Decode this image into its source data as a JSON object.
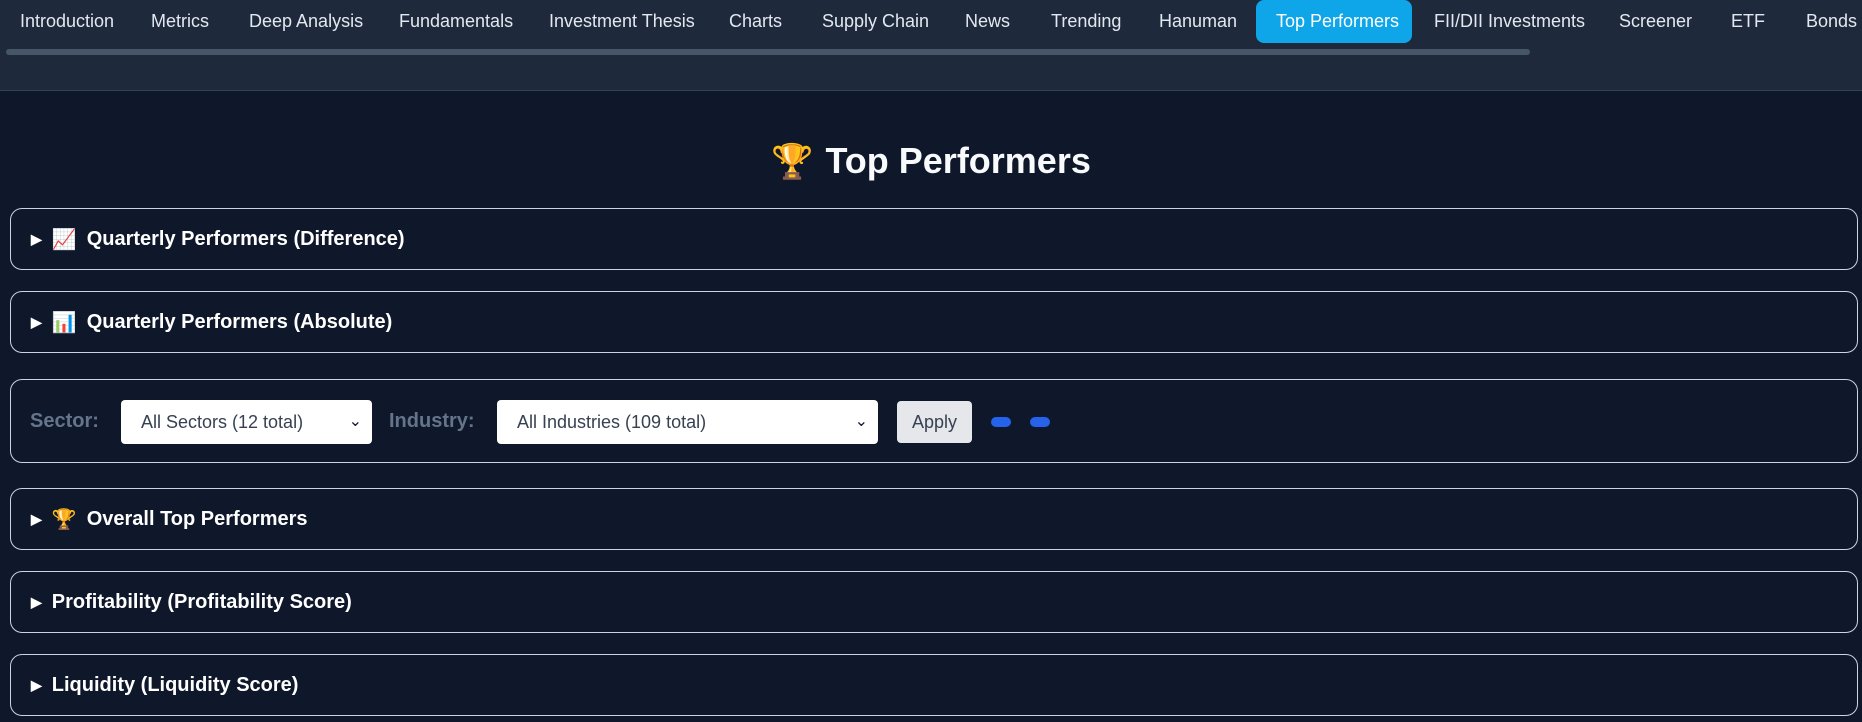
{
  "nav": {
    "tabs": [
      {
        "label": "Introduction",
        "active": false
      },
      {
        "label": "Metrics",
        "active": false
      },
      {
        "label": "Deep Analysis",
        "active": false
      },
      {
        "label": "Fundamentals",
        "active": false
      },
      {
        "label": "Investment Thesis",
        "active": false
      },
      {
        "label": "Charts",
        "active": false
      },
      {
        "label": "Supply Chain",
        "active": false
      },
      {
        "label": "News",
        "active": false
      },
      {
        "label": "Trending",
        "active": false
      },
      {
        "label": "Hanuman",
        "active": false
      },
      {
        "label": "Top Performers",
        "active": true
      },
      {
        "label": "FII/DII Investments",
        "active": false
      },
      {
        "label": "Screener",
        "active": false
      },
      {
        "label": "ETF",
        "active": false
      },
      {
        "label": "Bonds",
        "active": false
      }
    ]
  },
  "page": {
    "title": "Top Performers",
    "title_emoji": "🏆"
  },
  "sections": {
    "quarterly_diff": {
      "label": "Quarterly Performers (Difference)",
      "emoji": "📈"
    },
    "quarterly_abs": {
      "label": "Quarterly Performers (Absolute)",
      "emoji": "📊"
    },
    "overall": {
      "label": "Overall Top Performers",
      "emoji": "🏆"
    },
    "profitability": {
      "label": "Profitability (Profitability Score)"
    },
    "liquidity": {
      "label": "Liquidity (Liquidity Score)"
    }
  },
  "filters": {
    "sector_label": "Sector:",
    "sector_value": "All Sectors (12 total)",
    "industry_label": "Industry:",
    "industry_value": "All Industries (109 total)",
    "apply_label": "Apply"
  },
  "colors": {
    "background": "#0f172a",
    "nav_background": "#1e293b",
    "active_tab": "#0ea5e9",
    "panel_border": "#cbd5e1",
    "filter_label": "#64748b",
    "loading_dot": "#2563eb"
  },
  "icons": {
    "collapse": "triangle-right-icon",
    "select": "chevron-down-icon"
  }
}
